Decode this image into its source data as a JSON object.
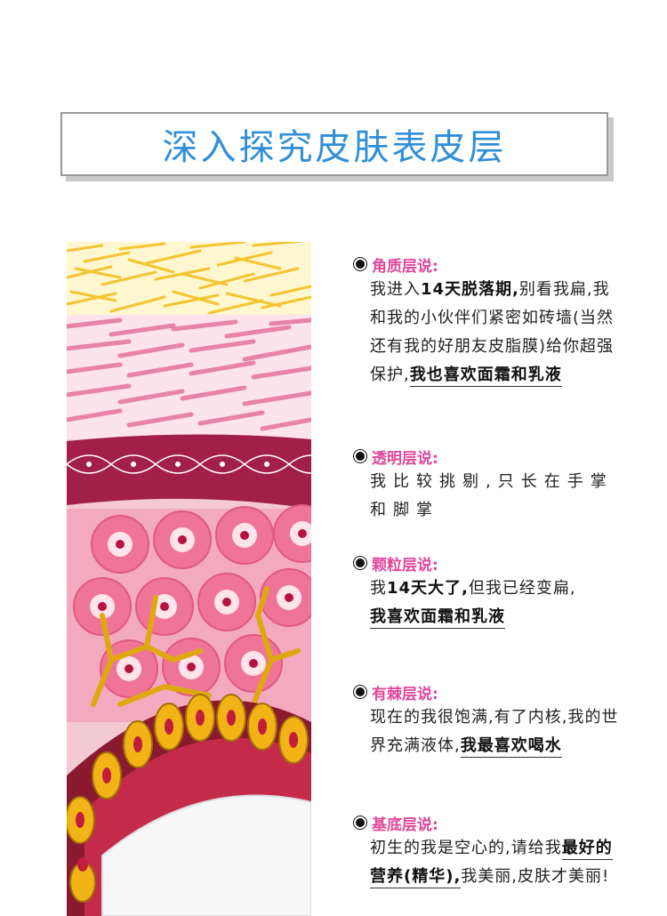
{
  "title": "深入探究皮肤表皮层",
  "sections": [
    {
      "heading": "角质层说:",
      "p1": "我进入",
      "b1": "14天脱落期,",
      "p2": "别看我扁,我和我的小伙伴们紧密如砖墙(当然还有我的好朋友皮脂膜)给你超强保护,",
      "b2": "我也喜欢面霜和乳液"
    },
    {
      "heading": "透明层说:",
      "p1": "我比较挑剔,只长在手掌和脚掌"
    },
    {
      "heading": "颗粒层说:",
      "p1": "我",
      "b1": "14天大了,",
      "p2": "但我已经变扁,",
      "b2": "我喜欢面霜和乳液"
    },
    {
      "heading": "有棘层说:",
      "p1": "现在的我很饱满,有了内核,我的世界充满液体,",
      "b1": "我最喜欢喝水"
    },
    {
      "heading": "基底层说:",
      "p1": "初生的我是空心的,请给我",
      "b1": "最好的营养(精华),",
      "p2": "我美丽,皮肤才美丽!"
    }
  ],
  "colors": {
    "heading_pink": "#e0489a",
    "title_blue": "#2f8fd8"
  }
}
